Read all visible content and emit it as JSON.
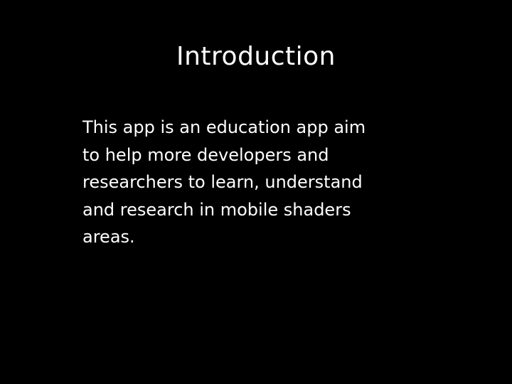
{
  "slide": {
    "title": "Introduction",
    "body_lines": [
      "This app is an education app aim",
      "to help more developers and",
      "researchers to learn, understand",
      "and research in mobile shaders",
      "areas."
    ]
  }
}
